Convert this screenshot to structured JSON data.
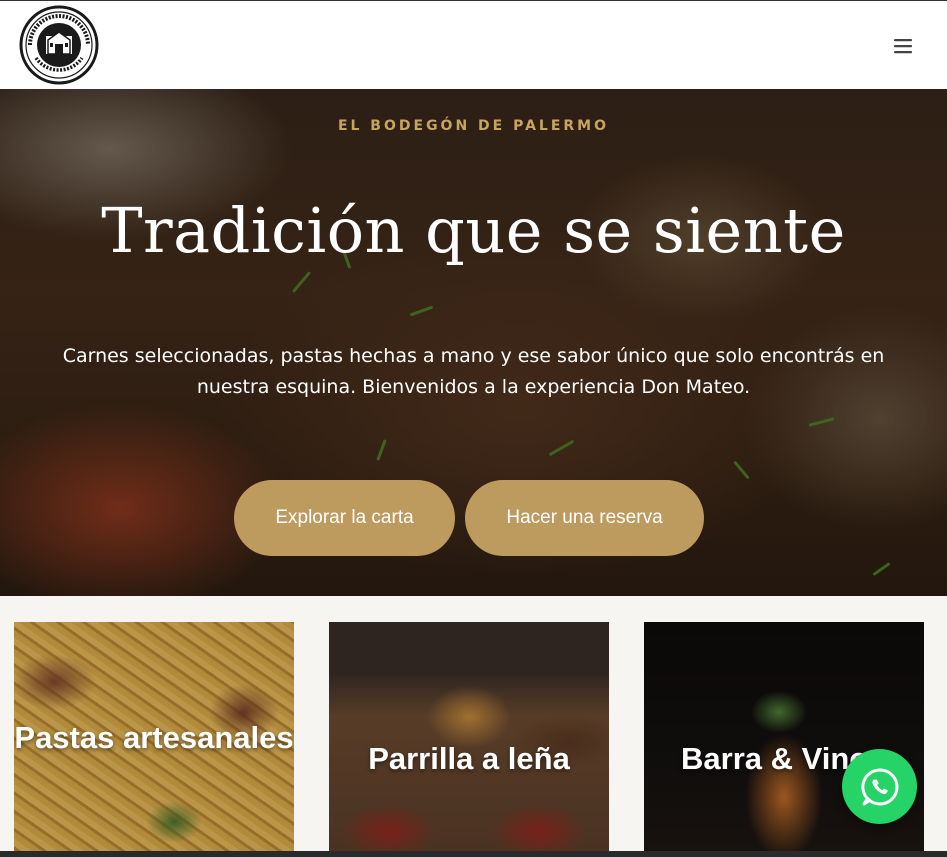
{
  "brand": {
    "logo_icon": "restaurant-seal-logo",
    "logo_text": "LA ESQUINA DE DON MATEO · BODEGÓN PORTEÑO"
  },
  "header": {
    "menu_icon": "hamburger-menu-icon"
  },
  "hero": {
    "eyebrow": "EL BODEGÓN DE PALERMO",
    "title": "Tradición que se siente",
    "subtitle": "Carnes seleccionadas, pastas hechas a mano y ese sabor único que solo encontrás en nuestra esquina. Bienvenidos a la experiencia Don Mateo.",
    "buttons": [
      {
        "label": "Explorar la carta"
      },
      {
        "label": "Hacer una reserva"
      }
    ]
  },
  "cards": [
    {
      "label": "Pastas artesanales"
    },
    {
      "label": "Parrilla a leña"
    },
    {
      "label": "Barra & Vinos"
    }
  ],
  "floating": {
    "whatsapp_icon": "whatsapp-icon"
  },
  "colors": {
    "accent": "#bd9a5e",
    "eyebrow": "#c9a45c",
    "whatsapp": "#25d366",
    "page_bg": "#f7f5f1"
  }
}
